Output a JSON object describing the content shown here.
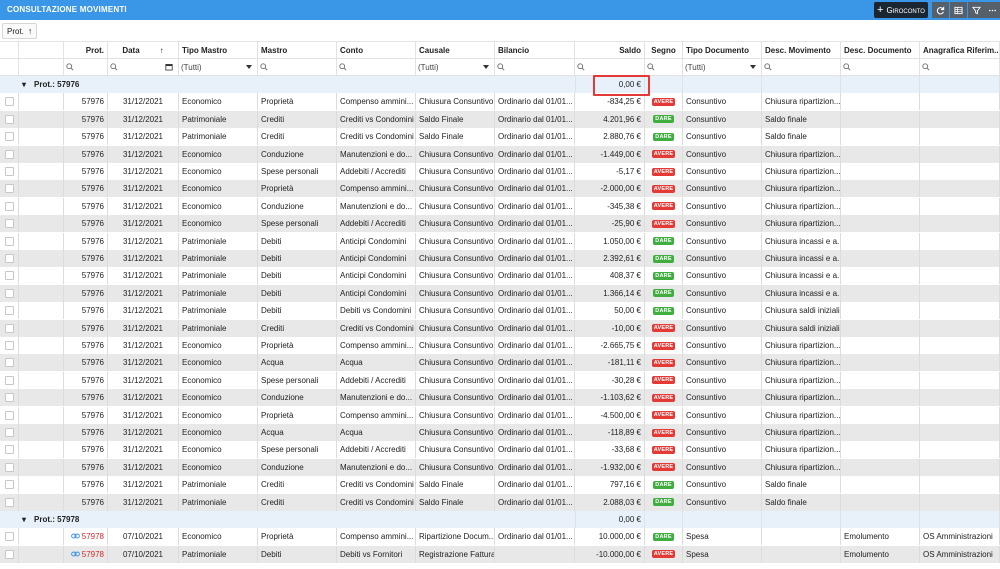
{
  "window": {
    "title": "CONSULTAZIONE MOVIMENTI",
    "giroconto_label": "Giroconto",
    "toolbar_icons": [
      "refresh-icon",
      "table-layout-icon",
      "filter-icon",
      "more-icon"
    ]
  },
  "grouping": {
    "chip_label": "Prot.",
    "sort_arrow": "↑"
  },
  "columns": [
    {
      "key": "prot",
      "label": "Prot."
    },
    {
      "key": "data",
      "label": "Data",
      "sort": "↑"
    },
    {
      "key": "tipo_mastro",
      "label": "Tipo Mastro"
    },
    {
      "key": "mastro",
      "label": "Mastro"
    },
    {
      "key": "conto",
      "label": "Conto"
    },
    {
      "key": "causale",
      "label": "Causale"
    },
    {
      "key": "bilancio",
      "label": "Bilancio"
    },
    {
      "key": "saldo",
      "label": "Saldo"
    },
    {
      "key": "segno",
      "label": "Segno"
    },
    {
      "key": "tipo_documento",
      "label": "Tipo Documento"
    },
    {
      "key": "desc_movimento",
      "label": "Desc. Movimento"
    },
    {
      "key": "desc_documento",
      "label": "Desc. Documento"
    },
    {
      "key": "anagrafica",
      "label": "Anagrafica Riferim..."
    }
  ],
  "filters": {
    "tipo_mastro": "(Tutti)",
    "causale": "(Tutti)",
    "tipo_documento": "(Tutti)"
  },
  "groups": [
    {
      "label": "Prot.: 57976",
      "saldo": "0,00 €",
      "rows": [
        {
          "prot": "57976",
          "data": "31/12/2021",
          "tipo_mastro": "Economico",
          "mastro": "Proprietà",
          "conto": "Compenso ammini...",
          "causale": "Chiusura Consuntivo",
          "bilancio": "Ordinario dal 01/01...",
          "saldo": "-834,25 €",
          "segno": "AVERE",
          "tipo_documento": "Consuntivo",
          "desc_movimento": "Chiusura ripartizion...",
          "desc_documento": "",
          "anagrafica": ""
        },
        {
          "prot": "57976",
          "data": "31/12/2021",
          "tipo_mastro": "Patrimoniale",
          "mastro": "Crediti",
          "conto": "Crediti vs Condomini",
          "causale": "Saldo Finale",
          "bilancio": "Ordinario dal 01/01...",
          "saldo": "4.201,96 €",
          "segno": "DARE",
          "tipo_documento": "Consuntivo",
          "desc_movimento": "Saldo finale",
          "desc_documento": "",
          "anagrafica": ""
        },
        {
          "prot": "57976",
          "data": "31/12/2021",
          "tipo_mastro": "Patrimoniale",
          "mastro": "Crediti",
          "conto": "Crediti vs Condomini",
          "causale": "Saldo Finale",
          "bilancio": "Ordinario dal 01/01...",
          "saldo": "2.880,76 €",
          "segno": "DARE",
          "tipo_documento": "Consuntivo",
          "desc_movimento": "Saldo finale",
          "desc_documento": "",
          "anagrafica": ""
        },
        {
          "prot": "57976",
          "data": "31/12/2021",
          "tipo_mastro": "Economico",
          "mastro": "Conduzione",
          "conto": "Manutenzioni e do...",
          "causale": "Chiusura Consuntivo",
          "bilancio": "Ordinario dal 01/01...",
          "saldo": "-1.449,00 €",
          "segno": "AVERE",
          "tipo_documento": "Consuntivo",
          "desc_movimento": "Chiusura ripartizion...",
          "desc_documento": "",
          "anagrafica": ""
        },
        {
          "prot": "57976",
          "data": "31/12/2021",
          "tipo_mastro": "Economico",
          "mastro": "Spese personali",
          "conto": "Addebiti / Accrediti",
          "causale": "Chiusura Consuntivo",
          "bilancio": "Ordinario dal 01/01...",
          "saldo": "-5,17 €",
          "segno": "AVERE",
          "tipo_documento": "Consuntivo",
          "desc_movimento": "Chiusura ripartizion...",
          "desc_documento": "",
          "anagrafica": ""
        },
        {
          "prot": "57976",
          "data": "31/12/2021",
          "tipo_mastro": "Economico",
          "mastro": "Proprietà",
          "conto": "Compenso ammini...",
          "causale": "Chiusura Consuntivo",
          "bilancio": "Ordinario dal 01/01...",
          "saldo": "-2.000,00 €",
          "segno": "AVERE",
          "tipo_documento": "Consuntivo",
          "desc_movimento": "Chiusura ripartizion...",
          "desc_documento": "",
          "anagrafica": ""
        },
        {
          "prot": "57976",
          "data": "31/12/2021",
          "tipo_mastro": "Economico",
          "mastro": "Conduzione",
          "conto": "Manutenzioni e do...",
          "causale": "Chiusura Consuntivo",
          "bilancio": "Ordinario dal 01/01...",
          "saldo": "-345,38 €",
          "segno": "AVERE",
          "tipo_documento": "Consuntivo",
          "desc_movimento": "Chiusura ripartizion...",
          "desc_documento": "",
          "anagrafica": ""
        },
        {
          "prot": "57976",
          "data": "31/12/2021",
          "tipo_mastro": "Economico",
          "mastro": "Spese personali",
          "conto": "Addebiti / Accrediti",
          "causale": "Chiusura Consuntivo",
          "bilancio": "Ordinario dal 01/01...",
          "saldo": "-25,90 €",
          "segno": "AVERE",
          "tipo_documento": "Consuntivo",
          "desc_movimento": "Chiusura ripartizion...",
          "desc_documento": "",
          "anagrafica": ""
        },
        {
          "prot": "57976",
          "data": "31/12/2021",
          "tipo_mastro": "Patrimoniale",
          "mastro": "Debiti",
          "conto": "Anticipi Condomini",
          "causale": "Chiusura Consuntivo",
          "bilancio": "Ordinario dal 01/01...",
          "saldo": "1.050,00 €",
          "segno": "DARE",
          "tipo_documento": "Consuntivo",
          "desc_movimento": "Chiusura incassi e a...",
          "desc_documento": "",
          "anagrafica": ""
        },
        {
          "prot": "57976",
          "data": "31/12/2021",
          "tipo_mastro": "Patrimoniale",
          "mastro": "Debiti",
          "conto": "Anticipi Condomini",
          "causale": "Chiusura Consuntivo",
          "bilancio": "Ordinario dal 01/01...",
          "saldo": "2.392,61 €",
          "segno": "DARE",
          "tipo_documento": "Consuntivo",
          "desc_movimento": "Chiusura incassi e a...",
          "desc_documento": "",
          "anagrafica": ""
        },
        {
          "prot": "57976",
          "data": "31/12/2021",
          "tipo_mastro": "Patrimoniale",
          "mastro": "Debiti",
          "conto": "Anticipi Condomini",
          "causale": "Chiusura Consuntivo",
          "bilancio": "Ordinario dal 01/01...",
          "saldo": "408,37 €",
          "segno": "DARE",
          "tipo_documento": "Consuntivo",
          "desc_movimento": "Chiusura incassi e a...",
          "desc_documento": "",
          "anagrafica": ""
        },
        {
          "prot": "57976",
          "data": "31/12/2021",
          "tipo_mastro": "Patrimoniale",
          "mastro": "Debiti",
          "conto": "Anticipi Condomini",
          "causale": "Chiusura Consuntivo",
          "bilancio": "Ordinario dal 01/01...",
          "saldo": "1.366,14 €",
          "segno": "DARE",
          "tipo_documento": "Consuntivo",
          "desc_movimento": "Chiusura incassi e a...",
          "desc_documento": "",
          "anagrafica": ""
        },
        {
          "prot": "57976",
          "data": "31/12/2021",
          "tipo_mastro": "Patrimoniale",
          "mastro": "Debiti",
          "conto": "Debiti vs Condomini",
          "causale": "Chiusura Consuntivo",
          "bilancio": "Ordinario dal 01/01...",
          "saldo": "50,00 €",
          "segno": "DARE",
          "tipo_documento": "Consuntivo",
          "desc_movimento": "Chiusura saldi iniziali",
          "desc_documento": "",
          "anagrafica": ""
        },
        {
          "prot": "57976",
          "data": "31/12/2021",
          "tipo_mastro": "Patrimoniale",
          "mastro": "Crediti",
          "conto": "Crediti vs Condomini",
          "causale": "Chiusura Consuntivo",
          "bilancio": "Ordinario dal 01/01...",
          "saldo": "-10,00 €",
          "segno": "AVERE",
          "tipo_documento": "Consuntivo",
          "desc_movimento": "Chiusura saldi iniziali",
          "desc_documento": "",
          "anagrafica": ""
        },
        {
          "prot": "57976",
          "data": "31/12/2021",
          "tipo_mastro": "Economico",
          "mastro": "Proprietà",
          "conto": "Compenso ammini...",
          "causale": "Chiusura Consuntivo",
          "bilancio": "Ordinario dal 01/01...",
          "saldo": "-2.665,75 €",
          "segno": "AVERE",
          "tipo_documento": "Consuntivo",
          "desc_movimento": "Chiusura ripartizion...",
          "desc_documento": "",
          "anagrafica": ""
        },
        {
          "prot": "57976",
          "data": "31/12/2021",
          "tipo_mastro": "Economico",
          "mastro": "Acqua",
          "conto": "Acqua",
          "causale": "Chiusura Consuntivo",
          "bilancio": "Ordinario dal 01/01...",
          "saldo": "-181,11 €",
          "segno": "AVERE",
          "tipo_documento": "Consuntivo",
          "desc_movimento": "Chiusura ripartizion...",
          "desc_documento": "",
          "anagrafica": ""
        },
        {
          "prot": "57976",
          "data": "31/12/2021",
          "tipo_mastro": "Economico",
          "mastro": "Spese personali",
          "conto": "Addebiti / Accrediti",
          "causale": "Chiusura Consuntivo",
          "bilancio": "Ordinario dal 01/01...",
          "saldo": "-30,28 €",
          "segno": "AVERE",
          "tipo_documento": "Consuntivo",
          "desc_movimento": "Chiusura ripartizion...",
          "desc_documento": "",
          "anagrafica": ""
        },
        {
          "prot": "57976",
          "data": "31/12/2021",
          "tipo_mastro": "Economico",
          "mastro": "Conduzione",
          "conto": "Manutenzioni e do...",
          "causale": "Chiusura Consuntivo",
          "bilancio": "Ordinario dal 01/01...",
          "saldo": "-1.103,62 €",
          "segno": "AVERE",
          "tipo_documento": "Consuntivo",
          "desc_movimento": "Chiusura ripartizion...",
          "desc_documento": "",
          "anagrafica": ""
        },
        {
          "prot": "57976",
          "data": "31/12/2021",
          "tipo_mastro": "Economico",
          "mastro": "Proprietà",
          "conto": "Compenso ammini...",
          "causale": "Chiusura Consuntivo",
          "bilancio": "Ordinario dal 01/01...",
          "saldo": "-4.500,00 €",
          "segno": "AVERE",
          "tipo_documento": "Consuntivo",
          "desc_movimento": "Chiusura ripartizion...",
          "desc_documento": "",
          "anagrafica": ""
        },
        {
          "prot": "57976",
          "data": "31/12/2021",
          "tipo_mastro": "Economico",
          "mastro": "Acqua",
          "conto": "Acqua",
          "causale": "Chiusura Consuntivo",
          "bilancio": "Ordinario dal 01/01...",
          "saldo": "-118,89 €",
          "segno": "AVERE",
          "tipo_documento": "Consuntivo",
          "desc_movimento": "Chiusura ripartizion...",
          "desc_documento": "",
          "anagrafica": ""
        },
        {
          "prot": "57976",
          "data": "31/12/2021",
          "tipo_mastro": "Economico",
          "mastro": "Spese personali",
          "conto": "Addebiti / Accrediti",
          "causale": "Chiusura Consuntivo",
          "bilancio": "Ordinario dal 01/01...",
          "saldo": "-33,68 €",
          "segno": "AVERE",
          "tipo_documento": "Consuntivo",
          "desc_movimento": "Chiusura ripartizion...",
          "desc_documento": "",
          "anagrafica": ""
        },
        {
          "prot": "57976",
          "data": "31/12/2021",
          "tipo_mastro": "Economico",
          "mastro": "Conduzione",
          "conto": "Manutenzioni e do...",
          "causale": "Chiusura Consuntivo",
          "bilancio": "Ordinario dal 01/01...",
          "saldo": "-1.932,00 €",
          "segno": "AVERE",
          "tipo_documento": "Consuntivo",
          "desc_movimento": "Chiusura ripartizion...",
          "desc_documento": "",
          "anagrafica": ""
        },
        {
          "prot": "57976",
          "data": "31/12/2021",
          "tipo_mastro": "Patrimoniale",
          "mastro": "Crediti",
          "conto": "Crediti vs Condomini",
          "causale": "Saldo Finale",
          "bilancio": "Ordinario dal 01/01...",
          "saldo": "797,16 €",
          "segno": "DARE",
          "tipo_documento": "Consuntivo",
          "desc_movimento": "Saldo finale",
          "desc_documento": "",
          "anagrafica": ""
        },
        {
          "prot": "57976",
          "data": "31/12/2021",
          "tipo_mastro": "Patrimoniale",
          "mastro": "Crediti",
          "conto": "Crediti vs Condomini",
          "causale": "Saldo Finale",
          "bilancio": "Ordinario dal 01/01...",
          "saldo": "2.088,03 €",
          "segno": "DARE",
          "tipo_documento": "Consuntivo",
          "desc_movimento": "Saldo finale",
          "desc_documento": "",
          "anagrafica": ""
        }
      ]
    },
    {
      "label": "Prot.: 57978",
      "saldo": "0,00 €",
      "rows": [
        {
          "prot": "57978",
          "link": true,
          "data": "07/10/2021",
          "tipo_mastro": "Economico",
          "mastro": "Proprietà",
          "conto": "Compenso ammini...",
          "causale": "Ripartizione Docum...",
          "bilancio": "Ordinario dal 01/01...",
          "saldo": "10.000,00 €",
          "segno": "DARE",
          "tipo_documento": "Spesa",
          "desc_movimento": "",
          "desc_documento": "Emolumento",
          "anagrafica": "OS Amministrazioni"
        },
        {
          "prot": "57978",
          "link": true,
          "data": "07/10/2021",
          "tipo_mastro": "Patrimoniale",
          "mastro": "Debiti",
          "conto": "Debiti vs Fornitori",
          "causale": "Registrazione Fattura",
          "bilancio": "",
          "saldo": "-10.000,00 €",
          "segno": "AVERE",
          "tipo_documento": "Spesa",
          "desc_movimento": "",
          "desc_documento": "Emolumento",
          "anagrafica": "OS Amministrazioni"
        }
      ]
    }
  ]
}
